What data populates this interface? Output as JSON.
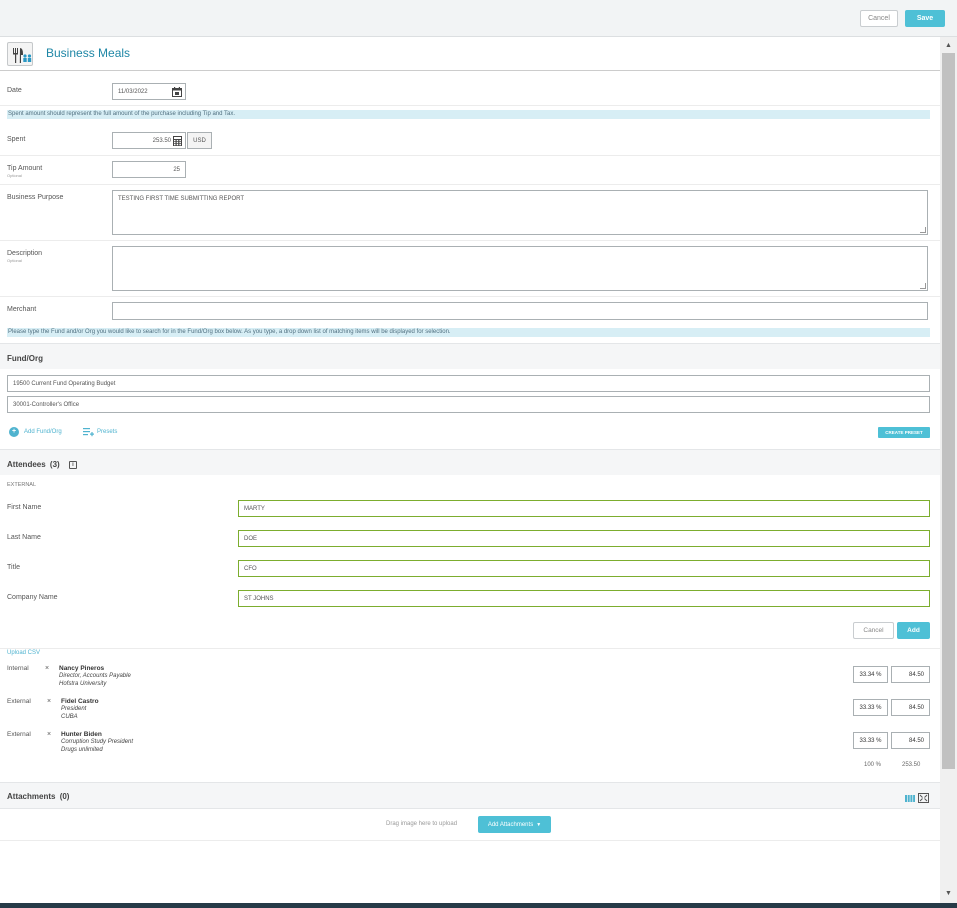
{
  "toolbar": {
    "cancel_label": "Cancel",
    "save_label": "Save"
  },
  "header": {
    "title": "Business Meals",
    "icon": "utensils-icon"
  },
  "form": {
    "date_label": "Date",
    "date_value": "11/03/2022",
    "spent_info": "Spent amount should represent the full amount of the purchase including Tip and Tax.",
    "spent_label": "Spent",
    "spent_value": "253.50",
    "currency": "USD",
    "tip_label": "Tip Amount",
    "tip_optional": "Optional",
    "tip_value": "25",
    "purpose_label": "Business Purpose",
    "purpose_value": "TESTING FIRST TIME SUBMITTING REPORT",
    "description_label": "Description",
    "description_optional": "Optional",
    "description_value": "",
    "merchant_label": "Merchant",
    "merchant_value": "",
    "fund_info": "Please type the Fund and/or Org you would like to search for in the Fund/Org box below. As you type, a drop down list of matching items will be displayed for selection."
  },
  "fund_org": {
    "title": "Fund/Org",
    "fund": "19500 Current Fund Operating Budget",
    "org": "30001-Controller's Office",
    "add_label": "Add Fund/Org",
    "presets_label": "Presets",
    "create_preset_label": "CREATE PRESET"
  },
  "attendees": {
    "title": "Attendees",
    "count": "(3)",
    "group_label": "EXTERNAL",
    "first_name_label": "First Name",
    "first_name_value": "MARTY",
    "last_name_label": "Last Name",
    "last_name_value": "DOE",
    "title_label": "Title",
    "title_value": "CFO",
    "company_label": "Company Name",
    "company_value": "ST JOHNS",
    "cancel_label": "Cancel",
    "add_label": "Add",
    "upload_csv_label": "Upload CSV",
    "list": [
      {
        "type": "Internal",
        "name": "Nancy Pineros",
        "line1": "Director, Accounts Payable",
        "line2": "Hofstra University",
        "pct": "33.34 %",
        "amount": "84.50"
      },
      {
        "type": "External",
        "name": "Fidel Castro",
        "line1": "President",
        "line2": "CUBA",
        "pct": "33.33 %",
        "amount": "84.50"
      },
      {
        "type": "External",
        "name": "Hunter Biden",
        "line1": "Corruption Study President",
        "line2": "Drugs unlimited",
        "pct": "33.33 %",
        "amount": "84.50"
      }
    ],
    "total_pct": "100 %",
    "total_amount": "253.50"
  },
  "attachments": {
    "title": "Attachments",
    "count": "(0)",
    "drag_text": "Drag image here to upload",
    "add_label": "Add Attachments"
  },
  "colors": {
    "accent": "#4ec0d6",
    "title": "#1f87a6",
    "valid": "#7cad2e",
    "info": "#d7eef5"
  }
}
